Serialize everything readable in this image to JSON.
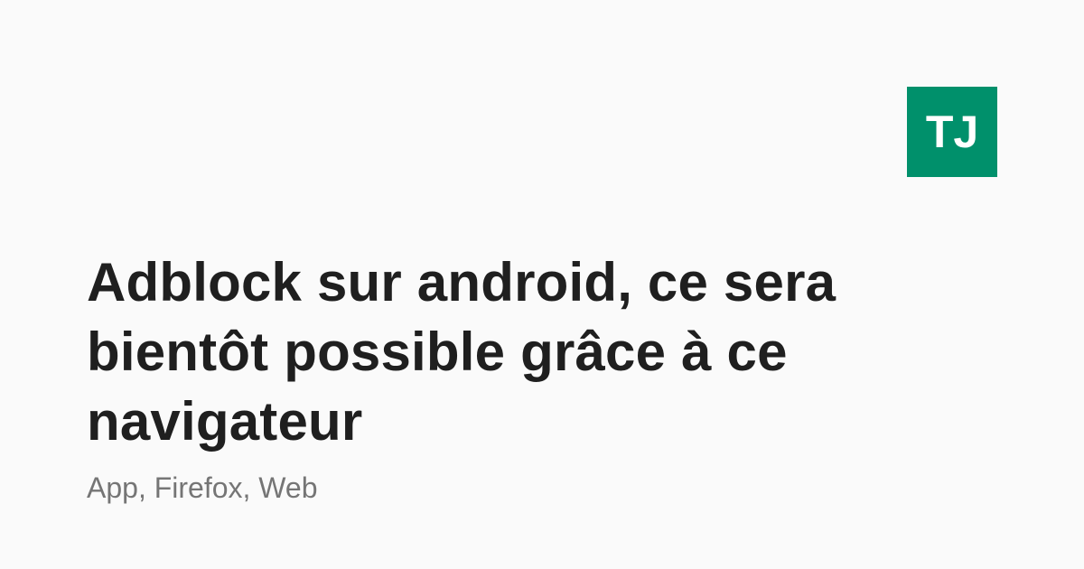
{
  "logo": {
    "text": "TJ",
    "background_color": "#00906b",
    "text_color": "#ffffff"
  },
  "article": {
    "title": "Adblock sur android, ce sera bientôt possible grâce à ce navigateur",
    "tags": "App, Firefox, Web"
  },
  "colors": {
    "background": "#fafafa",
    "title": "#1f1f1f",
    "tags": "#757575"
  }
}
